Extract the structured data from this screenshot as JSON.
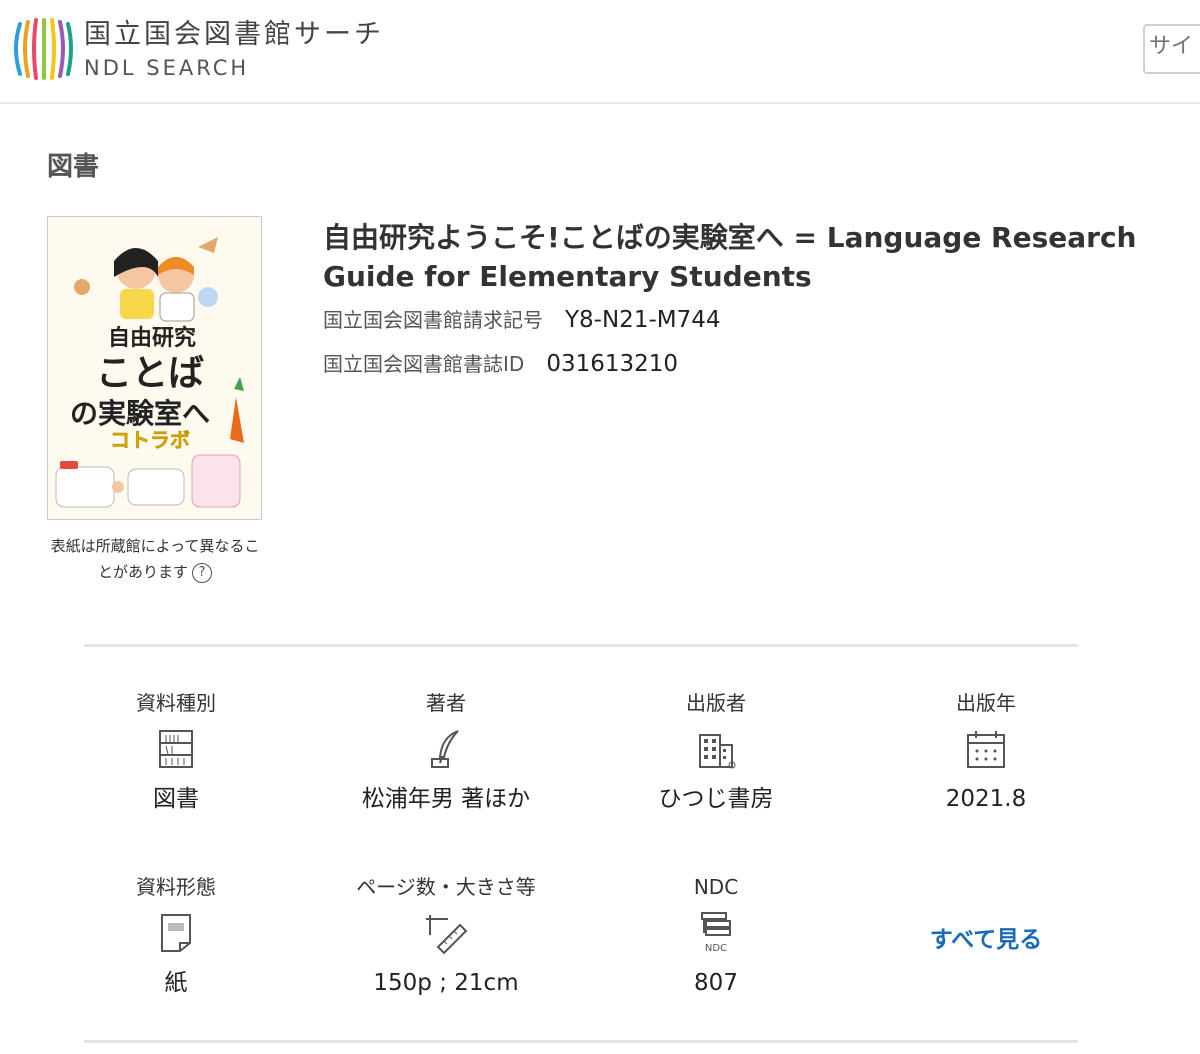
{
  "header": {
    "brand_jp": "国立国会図書館サーチ",
    "brand_en": "NDL SEARCH",
    "search_placeholder": "サイ"
  },
  "section": {
    "title": "図書"
  },
  "cover": {
    "caption": "表紙は所蔵館によって異なることがあります",
    "help_icon_text": "?"
  },
  "book": {
    "title": "自由研究ようこそ!ことばの実験室へ = Language Research Guide for Elementary Students",
    "call_number_label": "国立国会図書館請求記号",
    "call_number": "Y8-N21-M744",
    "bib_id_label": "国立国会図書館書誌ID",
    "bib_id": "031613210"
  },
  "attributes": {
    "material_type": {
      "label": "資料種別",
      "value": "図書",
      "icon": "bookshelf-icon"
    },
    "author": {
      "label": "著者",
      "value": "松浦年男 著ほか",
      "icon": "quill-pen-icon"
    },
    "publisher": {
      "label": "出版者",
      "value": "ひつじ書房",
      "icon": "buildings-icon"
    },
    "pub_year": {
      "label": "出版年",
      "value": "2021.8",
      "icon": "calendar-icon"
    },
    "form": {
      "label": "資料形態",
      "value": "紙",
      "icon": "paper-icon"
    },
    "pages": {
      "label": "ページ数・大きさ等",
      "value": "150p ; 21cm",
      "icon": "ruler-icon"
    },
    "ndc": {
      "label": "NDC",
      "value": "807",
      "icon": "ndc-icon",
      "icon_text": "NDC"
    }
  },
  "see_all_label": "すべて見る",
  "colors": {
    "link": "#1a6bb5",
    "divider": "#e3e3e3"
  }
}
